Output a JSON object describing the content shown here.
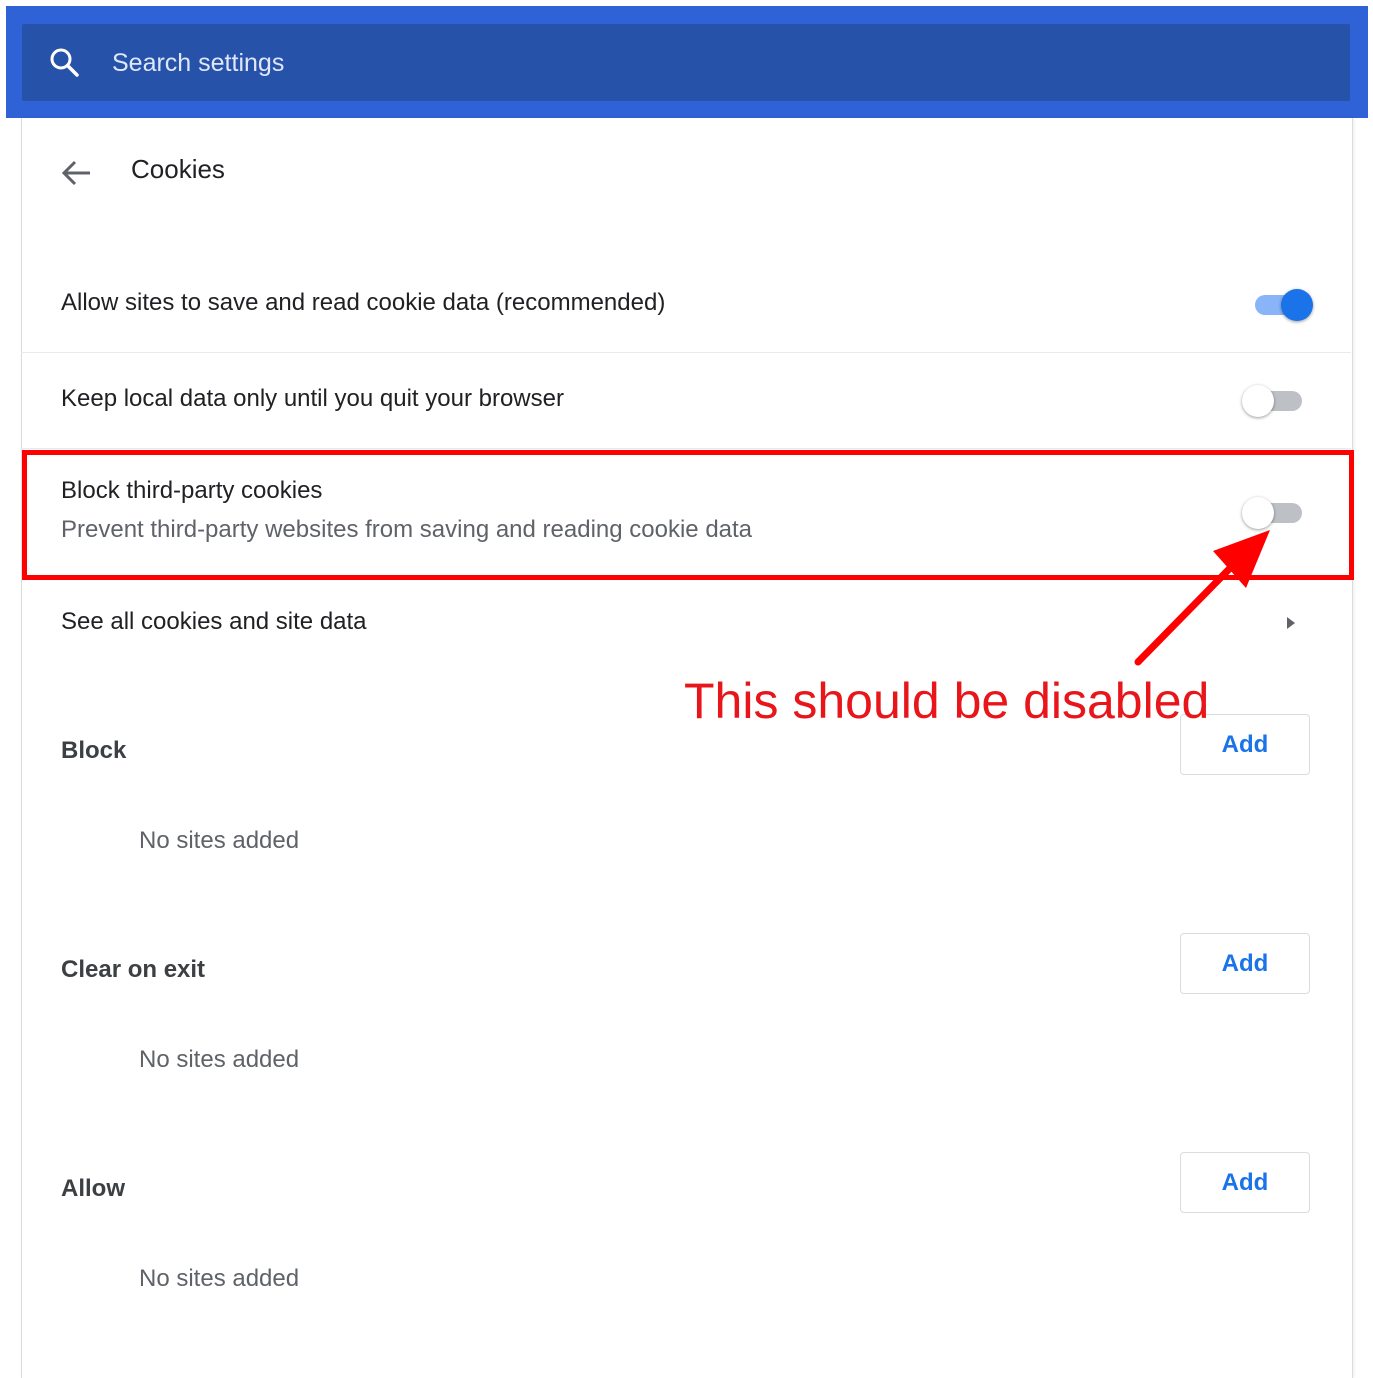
{
  "search": {
    "placeholder": "Search settings",
    "icon": "search-icon"
  },
  "header": {
    "title": "Cookies",
    "back_icon": "arrow-left-icon"
  },
  "settings": [
    {
      "label": "Allow sites to save and read cookie data (recommended)",
      "enabled": true
    },
    {
      "label": "Keep local data only until you quit your browser",
      "enabled": false
    },
    {
      "label": "Block third-party cookies",
      "description": "Prevent third-party websites from saving and reading cookie data",
      "enabled": false
    }
  ],
  "see_all": {
    "label": "See all cookies and site data",
    "icon": "chevron-right-icon"
  },
  "sections": [
    {
      "title": "Block",
      "add_label": "Add",
      "empty_text": "No sites added"
    },
    {
      "title": "Clear on exit",
      "add_label": "Add",
      "empty_text": "No sites added"
    },
    {
      "title": "Allow",
      "add_label": "Add",
      "empty_text": "No sites added"
    }
  ],
  "annotation": {
    "text": "This should be disabled",
    "color": "#e8161b"
  },
  "colors": {
    "header_blue": "#2f62d6",
    "search_bar": "#2752aa",
    "accent": "#1a73e8",
    "highlight": "#ff0000"
  }
}
